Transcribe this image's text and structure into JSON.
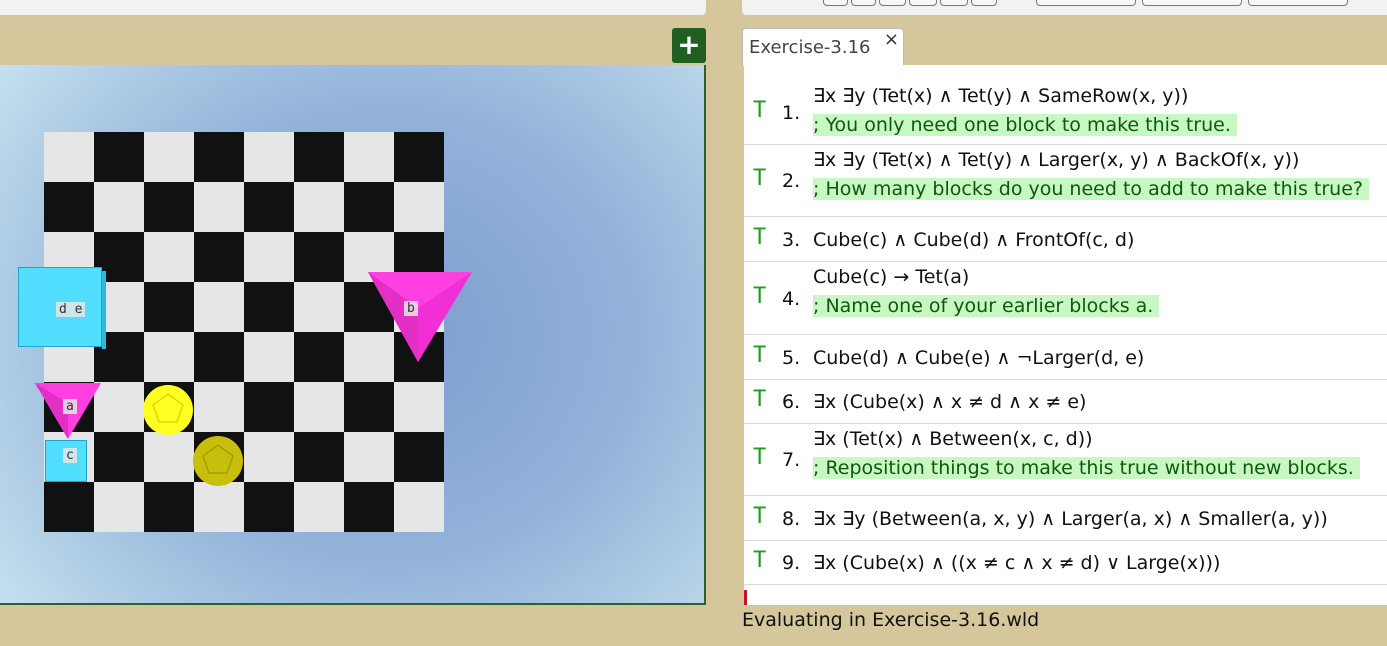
{
  "add_button": {
    "label": "+"
  },
  "tab": {
    "label": "Exercise-3.16",
    "close": "×"
  },
  "blocks": {
    "de": "d e",
    "b": "b",
    "a": "a",
    "c": "c"
  },
  "sentences": [
    {
      "truth": "T",
      "num": "1.",
      "formula": "∃x ∃y (Tet(x) ∧ Tet(y) ∧ SameRow(x, y))",
      "comment": "; You only need one block to make this true."
    },
    {
      "truth": "T",
      "num": "2.",
      "formula": "∃x ∃y (Tet(x) ∧ Tet(y) ∧ Larger(x, y) ∧ BackOf(x, y))",
      "comment": "; How many blocks do you need to add to make this true?"
    },
    {
      "truth": "T",
      "num": "3.",
      "formula": "Cube(c) ∧ Cube(d) ∧ FrontOf(c, d)",
      "comment": ""
    },
    {
      "truth": "T",
      "num": "4.",
      "formula": "Cube(c) → Tet(a)",
      "comment": "; Name one of your earlier blocks a."
    },
    {
      "truth": "T",
      "num": "5.",
      "formula": "Cube(d) ∧ Cube(e) ∧ ¬Larger(d, e)",
      "comment": ""
    },
    {
      "truth": "T",
      "num": "6.",
      "formula": "∃x (Cube(x) ∧ x ≠ d ∧ x ≠ e)",
      "comment": ""
    },
    {
      "truth": "T",
      "num": "7.",
      "formula": "∃x (Tet(x) ∧ Between(x, c, d))",
      "comment": "; Reposition things to make this true without new blocks."
    },
    {
      "truth": "T",
      "num": "8.",
      "formula": "∃x ∃y (Between(a, x, y) ∧ Larger(a, x) ∧ Smaller(a, y))",
      "comment": ""
    },
    {
      "truth": "T",
      "num": "9.",
      "formula": "∃x (Cube(x) ∧ ((x ≠ c ∧ x ≠ d) ∨ Large(x)))",
      "comment": ""
    }
  ],
  "status": "Evaluating in Exercise-3.16.wld",
  "colors": {
    "truth_green": "#1f9d1f",
    "comment_bg": "#c9f7c3",
    "accent_green": "#215e21"
  }
}
